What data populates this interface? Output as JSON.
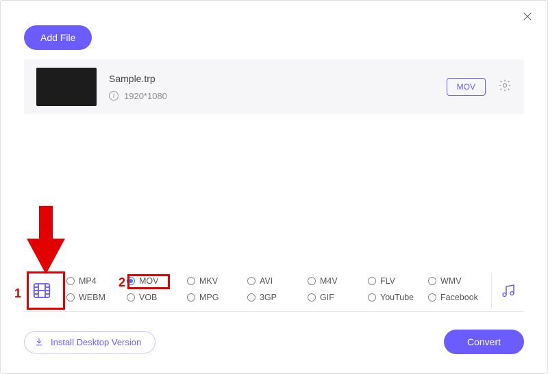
{
  "buttons": {
    "add_file": "Add File",
    "install_desktop": "Install Desktop Version",
    "convert": "Convert"
  },
  "file": {
    "name": "Sample.trp",
    "resolution": "1920*1080",
    "output_format": "MOV"
  },
  "formats": {
    "row1": [
      "MP4",
      "MOV",
      "MKV",
      "AVI",
      "M4V",
      "FLV",
      "WMV"
    ],
    "row2": [
      "WEBM",
      "VOB",
      "MPG",
      "3GP",
      "GIF",
      "YouTube",
      "Facebook"
    ],
    "selected": "MOV"
  },
  "icons": {
    "video_tab": "video-icon",
    "audio_tab": "music-icon"
  },
  "annotations": {
    "num1": "1",
    "num2": "2"
  }
}
